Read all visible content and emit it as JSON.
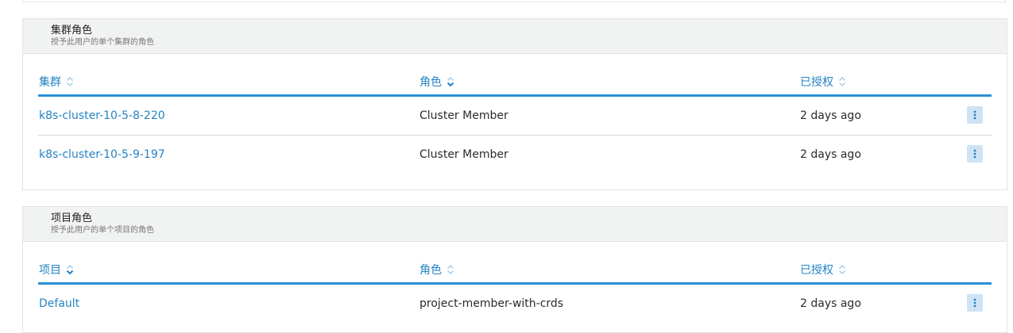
{
  "clusters_section": {
    "title": "集群角色",
    "subtitle": "授予此用户的单个集群的角色",
    "columns": [
      "集群",
      "角色",
      "已授权"
    ],
    "rows": [
      {
        "name": "k8s-cluster-10-5-8-220",
        "role": "Cluster Member",
        "granted": "2 days ago"
      },
      {
        "name": "k8s-cluster-10-5-9-197",
        "role": "Cluster Member",
        "granted": "2 days ago"
      }
    ]
  },
  "projects_section": {
    "title": "项目角色",
    "subtitle": "授予此用户的单个项目的角色",
    "columns": [
      "项目",
      "角色",
      "已授权"
    ],
    "rows": [
      {
        "name": "Default",
        "role": "project-member-with-crds",
        "granted": "2 days ago"
      }
    ]
  },
  "icons": {
    "sort": "sort-unsorted-icon",
    "sort_active": "sort-descending-icon",
    "actions": "kebab-menu-icon"
  },
  "colors": {
    "link": "#2583c4",
    "accent_border": "#2a8fd6",
    "action_bg": "#cfe3f5",
    "header_bg": "#f1f2f2"
  }
}
